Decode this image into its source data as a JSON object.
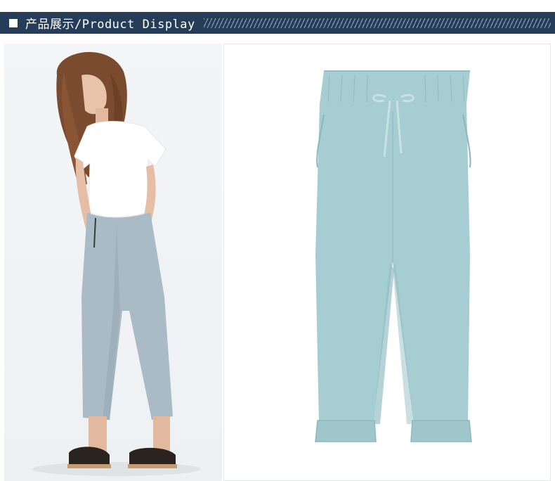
{
  "header": {
    "square_icon": "square-bullet-icon",
    "title": "产品展示/Product Display"
  },
  "colors": {
    "banner": "#263d59",
    "pants_model": "#a9bcc6",
    "pants_product": "#a6cdd1"
  },
  "images": {
    "left": "model-wearing-pants-photo",
    "right": "pants-flatlay-photo"
  }
}
